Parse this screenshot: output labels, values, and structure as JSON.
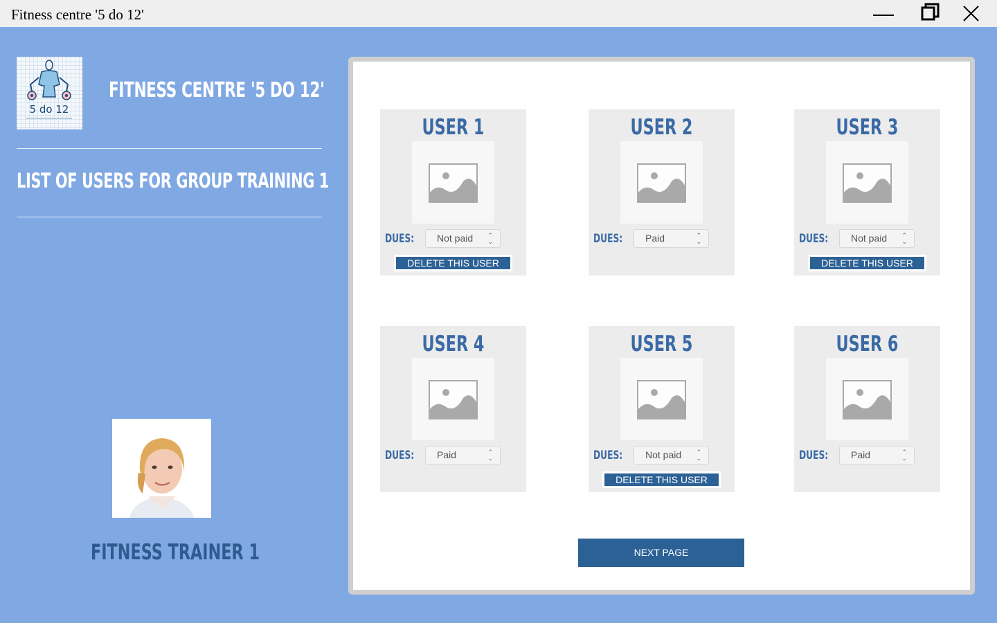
{
  "window": {
    "title": "Fitness centre '5 do 12'",
    "controls": {
      "minimize": "minimize-icon",
      "restore": "restore-icon",
      "close": "close-icon"
    }
  },
  "sidebar": {
    "logo_text": "5 do 12",
    "logo_icon": "bodybuilder-icon",
    "app_title": "FITNESS CENTRE '5 DO 12'",
    "list_title": "LIST OF USERS FOR GROUP TRAINING 1",
    "trainer_name": "FITNESS TRAINER 1"
  },
  "users": [
    {
      "title": "USER 1",
      "dues_label": "DUES:",
      "dues_value": "Not paid",
      "delete_label": "DELETE THIS USER"
    },
    {
      "title": "USER 2",
      "dues_label": "DUES:",
      "dues_value": "Paid",
      "delete_label": ""
    },
    {
      "title": "USER 3",
      "dues_label": "DUES:",
      "dues_value": "Not paid",
      "delete_label": "DELETE THIS USER"
    },
    {
      "title": "USER 4",
      "dues_label": "DUES:",
      "dues_value": "Paid",
      "delete_label": ""
    },
    {
      "title": "USER 5",
      "dues_label": "DUES:",
      "dues_value": "Not paid",
      "delete_label": "DELETE THIS USER"
    },
    {
      "title": "USER 6",
      "dues_label": "DUES:",
      "dues_value": "Paid",
      "delete_label": ""
    }
  ],
  "next_button": "NEXT PAGE",
  "colors": {
    "background": "#80a8e3",
    "accent": "#2c6195",
    "heading": "#3a6aa6"
  }
}
